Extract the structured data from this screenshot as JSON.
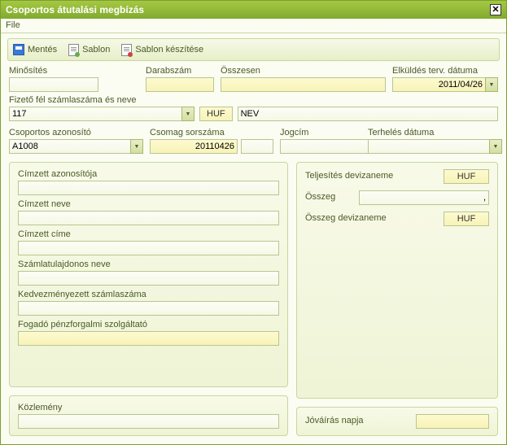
{
  "window": {
    "title": "Csoportos átutalási megbízás"
  },
  "menu": {
    "file": "File"
  },
  "toolbar": {
    "save": "Mentés",
    "template": "Sablon",
    "make_template": "Sablon készítése"
  },
  "top": {
    "minosites": {
      "label": "Minősítés",
      "value": ""
    },
    "darabszam": {
      "label": "Darabszám",
      "value": ""
    },
    "osszesen": {
      "label": "Összesen",
      "value": ""
    },
    "elkuldes": {
      "label": "Elküldés terv. dátuma",
      "value": "2011/04/26"
    }
  },
  "payer": {
    "label": "Fizető fél számlaszáma és neve",
    "account": "117",
    "currency": "HUF",
    "name": "NEV"
  },
  "group": {
    "azonosito": {
      "label": "Csoportos azonosító",
      "value": "A1008"
    },
    "csomag": {
      "label": "Csomag sorszáma",
      "value": "20110426",
      "extra": ""
    },
    "jogcim": {
      "label": "Jogcím",
      "value": ""
    },
    "terheles": {
      "label": "Terhelés dátuma",
      "value": ""
    }
  },
  "recipient": {
    "azonosito": {
      "label": "Címzett azonosítója",
      "value": ""
    },
    "neve": {
      "label": "Címzett neve",
      "value": ""
    },
    "cime": {
      "label": "Címzett címe",
      "value": ""
    },
    "tulajdonos": {
      "label": "Számlatulajdonos neve",
      "value": ""
    },
    "kedvezmenyezett": {
      "label": "Kedvezményezett számlaszáma",
      "value": ""
    },
    "fogado": {
      "label": "Fogadó pénzforgalmi szolgáltató",
      "value": ""
    }
  },
  "amount": {
    "teljesites_deviza": {
      "label": "Teljesítés devizaneme",
      "value": "HUF"
    },
    "osszeg": {
      "label": "Összeg",
      "value": ","
    },
    "osszeg_deviza": {
      "label": "Összeg devizaneme",
      "value": "HUF"
    }
  },
  "kozlemeny": {
    "label": "Közlemény",
    "value": ""
  },
  "jovairas": {
    "label": "Jóváírás napja",
    "value": ""
  }
}
